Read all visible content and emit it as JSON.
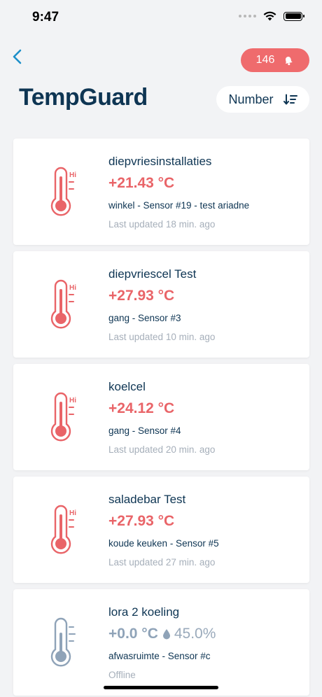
{
  "status_bar": {
    "time": "9:47"
  },
  "header": {
    "title": "TempGuard",
    "alert_count": "146",
    "sort_label": "Number"
  },
  "colors": {
    "alert": "#ef6b6d",
    "title": "#0e3553",
    "hot": "#e96468",
    "offline": "#8fa3b8"
  },
  "sensors": [
    {
      "name": "diepvriesinstallaties",
      "temperature": "+21.43 °C",
      "location": "winkel - Sensor #19 - test ariadne",
      "updated": "Last updated 18 min. ago",
      "icon": "thermometer-hi-icon"
    },
    {
      "name": "diepvriescel Test",
      "temperature": "+27.93 °C",
      "location": "gang - Sensor #3",
      "updated": "Last updated 10 min. ago",
      "icon": "thermometer-hi-icon"
    },
    {
      "name": "koelcel",
      "temperature": "+24.12 °C",
      "location": "gang - Sensor #4",
      "updated": "Last updated 20 min. ago",
      "icon": "thermometer-hi-icon"
    },
    {
      "name": "saladebar Test",
      "temperature": "+27.93 °C",
      "location": "koude keuken - Sensor #5",
      "updated": "Last updated 27 min. ago",
      "icon": "thermometer-hi-icon"
    },
    {
      "name": "lora 2 koeling",
      "temperature": "+0.0 °C",
      "humidity": "45.0%",
      "location": "afwasruimte - Sensor #c",
      "updated": "Offline",
      "icon": "thermometer-offline-icon"
    }
  ]
}
